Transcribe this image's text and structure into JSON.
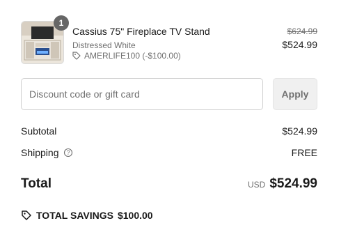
{
  "line_item": {
    "quantity": "1",
    "name": "Cassius 75\" Fireplace TV Stand",
    "variant": "Distressed White",
    "discount_code": "AMERLIFE100 (-$100.00)",
    "compare_price": "$624.99",
    "price": "$524.99"
  },
  "discount_form": {
    "placeholder": "Discount code or gift card",
    "apply_label": "Apply"
  },
  "summary": {
    "subtotal_label": "Subtotal",
    "subtotal_value": "$524.99",
    "shipping_label": "Shipping",
    "shipping_value": "FREE",
    "total_label": "Total",
    "currency": "USD",
    "total_value": "$524.99",
    "savings_label": "TOTAL SAVINGS",
    "savings_value": "$100.00"
  },
  "colors": {
    "text": "#1a1a1a",
    "muted": "#707070",
    "badge": "#666666",
    "button_bg": "#f0f0f0"
  }
}
